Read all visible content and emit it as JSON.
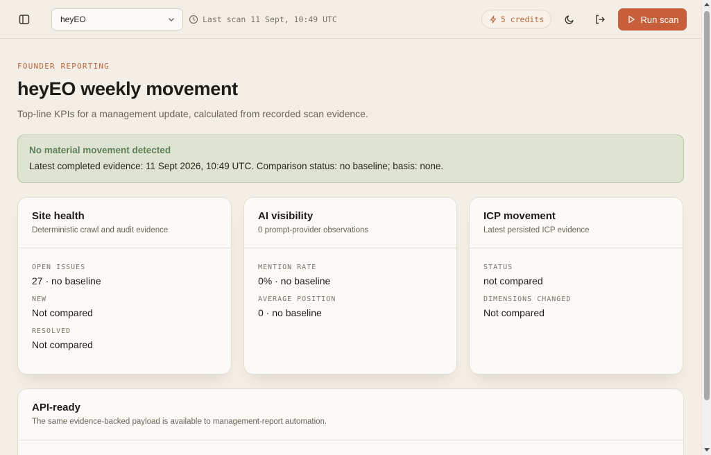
{
  "topbar": {
    "project": "heyEO",
    "last_scan": "Last scan 11 Sept, 10:49 UTC",
    "credits": "5 credits",
    "run_scan": "Run scan"
  },
  "header": {
    "eyebrow": "FOUNDER REPORTING",
    "title": "heyEO weekly movement",
    "subtitle": "Top-line KPIs for a management update, calculated from recorded scan evidence."
  },
  "alert": {
    "title": "No material movement detected",
    "body": "Latest completed evidence: 11 Sept 2026, 10:49 UTC. Comparison status: no baseline; basis: none."
  },
  "cards": [
    {
      "title": "Site health",
      "desc": "Deterministic crawl and audit evidence",
      "metrics": [
        {
          "label": "OPEN ISSUES",
          "value": "27 · no baseline"
        },
        {
          "label": "NEW",
          "value": "Not compared"
        },
        {
          "label": "RESOLVED",
          "value": "Not compared"
        }
      ]
    },
    {
      "title": "AI visibility",
      "desc": "0 prompt-provider observations",
      "metrics": [
        {
          "label": "MENTION RATE",
          "value": "0% · no baseline"
        },
        {
          "label": "AVERAGE POSITION",
          "value": "0 · no baseline"
        }
      ]
    },
    {
      "title": "ICP movement",
      "desc": "Latest persisted ICP evidence",
      "metrics": [
        {
          "label": "STATUS",
          "value": "not compared"
        },
        {
          "label": "DIMENSIONS CHANGED",
          "value": "Not compared"
        }
      ]
    }
  ],
  "api": {
    "title": "API-ready",
    "desc": "The same evidence-backed payload is available to management-report automation."
  },
  "colors": {
    "accent": "#c65f3a",
    "success_text": "#5c7f5a",
    "alert_bg": "#dfe3d1",
    "page_bg": "#f4efe6"
  }
}
